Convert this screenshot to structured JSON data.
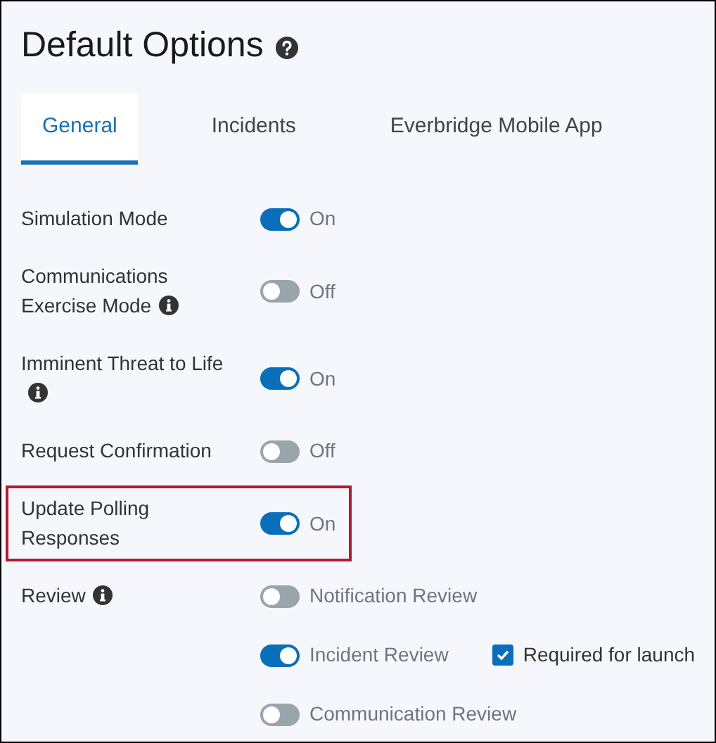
{
  "title": "Default Options",
  "tabs": [
    {
      "label": "General",
      "selected": true
    },
    {
      "label": "Incidents",
      "selected": false
    },
    {
      "label": "Everbridge Mobile App",
      "selected": false
    }
  ],
  "settings": [
    {
      "kind": "toggle",
      "label": "Simulation Mode",
      "info": false,
      "on": true,
      "state_label": "On",
      "highlighted": false
    },
    {
      "kind": "toggle",
      "label": "Communications Exercise Mode",
      "info": true,
      "on": false,
      "state_label": "Off",
      "highlighted": false
    },
    {
      "kind": "toggle",
      "label": "Imminent Threat to Life",
      "info": true,
      "on": true,
      "state_label": "On",
      "highlighted": false
    },
    {
      "kind": "toggle",
      "label": "Request Confirmation",
      "info": false,
      "on": false,
      "state_label": "Off",
      "highlighted": false
    },
    {
      "kind": "toggle",
      "label": "Update Polling Responses",
      "info": false,
      "on": true,
      "state_label": "On",
      "highlighted": true
    },
    {
      "kind": "group",
      "label": "Review",
      "info": true,
      "highlighted": false,
      "options": [
        {
          "label": "Notification Review",
          "on": false
        },
        {
          "label": "Incident Review",
          "on": true,
          "checkbox": {
            "label": "Required for launch",
            "checked": true
          }
        },
        {
          "label": "Communication Review",
          "on": false
        }
      ]
    }
  ]
}
